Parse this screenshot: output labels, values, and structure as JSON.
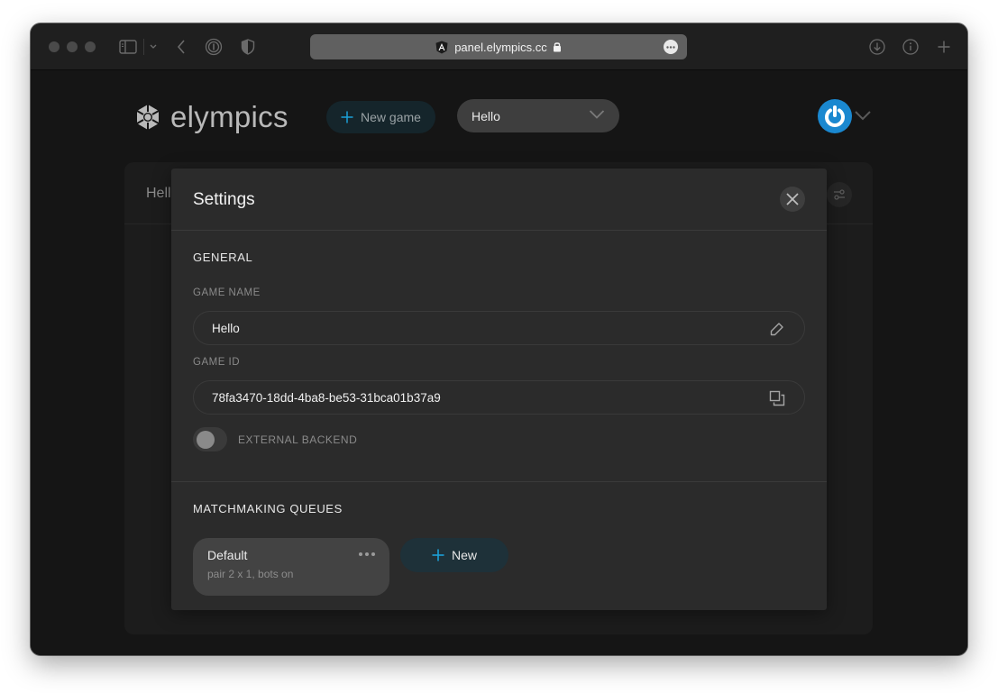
{
  "browser": {
    "url": "panel.elympics.cc",
    "toolbar_icons": [
      "sidebar-icon",
      "chevron-down-icon",
      "back-icon",
      "password-manager-icon",
      "shield-icon",
      "download-icon",
      "info-icon",
      "new-tab-icon"
    ]
  },
  "header": {
    "brand": "elympics",
    "new_game_label": "New game",
    "game_select_value": "Hello"
  },
  "background_card": {
    "title": "Hell"
  },
  "modal": {
    "title": "Settings",
    "general": {
      "heading": "GENERAL",
      "game_name_label": "GAME NAME",
      "game_name_value": "Hello",
      "game_id_label": "GAME ID",
      "game_id_value": "78fa3470-18dd-4ba8-be53-31bca01b37a9",
      "external_backend_label": "EXTERNAL BACKEND",
      "external_backend_enabled": false
    },
    "matchmaking": {
      "heading": "MATCHMAKING QUEUES",
      "queues": [
        {
          "name": "Default",
          "description": "pair 2 x 1, bots on"
        }
      ],
      "new_label": "New"
    }
  },
  "colors": {
    "accent": "#1ba0d8",
    "avatar": "#1a88d0",
    "modal_bg": "#2b2b2b",
    "page_bg": "#151515"
  }
}
